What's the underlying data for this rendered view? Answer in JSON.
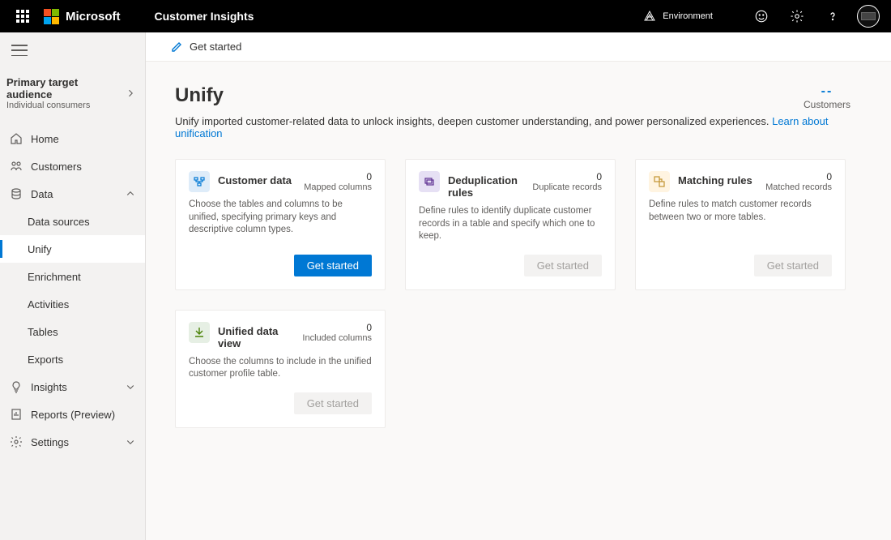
{
  "topbar": {
    "brand": "Microsoft",
    "product": "Customer Insights",
    "environment_label": "Environment"
  },
  "sidebar": {
    "audience_title": "Primary target audience",
    "audience_subtitle": "Individual consumers",
    "items": {
      "home": "Home",
      "customers": "Customers",
      "data": "Data",
      "data_sources": "Data sources",
      "unify": "Unify",
      "enrichment": "Enrichment",
      "activities": "Activities",
      "tables": "Tables",
      "exports": "Exports",
      "insights": "Insights",
      "reports": "Reports (Preview)",
      "settings": "Settings"
    }
  },
  "cmdbar": {
    "get_started": "Get started"
  },
  "page": {
    "title": "Unify",
    "description": "Unify imported customer-related data to unlock insights, deepen customer understanding, and power personalized experiences. ",
    "learn_link": "Learn about unification",
    "customers_value": "--",
    "customers_label": "Customers"
  },
  "cards": [
    {
      "title": "Customer data",
      "metric_value": "0",
      "metric_label": "Mapped columns",
      "desc": "Choose the tables and columns to be unified, specifying primary keys and descriptive column types.",
      "button": "Get started",
      "enabled": true
    },
    {
      "title": "Deduplication rules",
      "metric_value": "0",
      "metric_label": "Duplicate records",
      "desc": "Define rules to identify duplicate customer records in a table and specify which one to keep.",
      "button": "Get started",
      "enabled": false
    },
    {
      "title": "Matching rules",
      "metric_value": "0",
      "metric_label": "Matched records",
      "desc": "Define rules to match customer records between two or more tables.",
      "button": "Get started",
      "enabled": false
    },
    {
      "title": "Unified data view",
      "metric_value": "0",
      "metric_label": "Included columns",
      "desc": "Choose the columns to include in the unified customer profile table.",
      "button": "Get started",
      "enabled": false
    }
  ]
}
